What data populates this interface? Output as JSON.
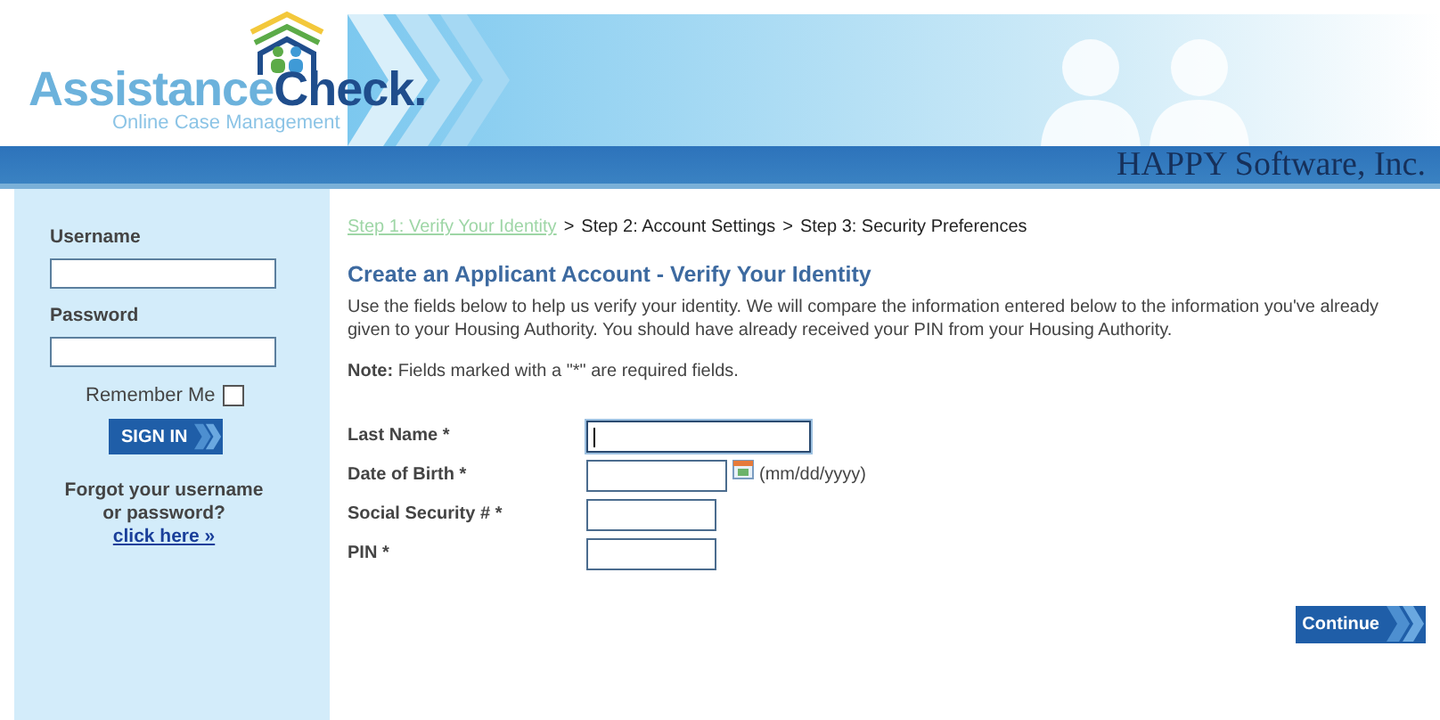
{
  "header": {
    "logo": {
      "word_1": "Assistance",
      "word_2": "Check.",
      "tagline": "Online Case Management"
    },
    "company": "HAPPY Software, Inc."
  },
  "sidebar": {
    "username_label": "Username",
    "password_label": "Password",
    "remember": {
      "label": "Remember Me",
      "checked": false
    },
    "sign_in": "SIGN IN",
    "forgot": "Forgot your username or password?",
    "forgot_link": "click here »"
  },
  "breadcrumb": [
    {
      "label": "Step 1: Verify Your Identity",
      "selected": true
    },
    {
      "label": "Step 2: Account Settings",
      "selected": false
    },
    {
      "label": "Step 3: Security Preferences",
      "selected": false
    }
  ],
  "breadcrumb_separator": ">",
  "title": "Create an Applicant Account - Verify Your Identity",
  "intro": "Use the fields below to help us verify your identity. We will compare the information entered below to the information you've already given to your Housing Authority. You should have already received your PIN from your Housing Authority.",
  "note": "**Note:** Fields marked with a \"*\" are required fields.",
  "fields": [
    {
      "label": "Last Name *",
      "kind": "text",
      "focused": true
    },
    {
      "label": "Date of Birth *",
      "kind": "date",
      "focused": false,
      "hint": "(mm/dd/yyyy)"
    },
    {
      "label": "Social Security # *",
      "kind": "short",
      "focused": false
    },
    {
      "label": "PIN *",
      "kind": "short",
      "focused": false
    }
  ],
  "continue": "Continue"
}
